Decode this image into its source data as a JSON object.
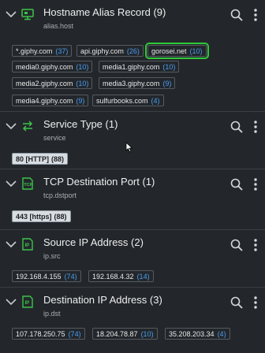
{
  "panels": [
    {
      "title": "Hostname Alias Record (9)",
      "field": "alias.host",
      "icon": "monitor-icon",
      "chips": [
        {
          "label": "*.giphy.com",
          "count": "(37)"
        },
        {
          "label": "api.giphy.com",
          "count": "(26)"
        },
        {
          "label": "gorosei.net",
          "count": "(10)",
          "highlighted": true
        },
        {
          "label": "media0.giphy.com",
          "count": "(10)"
        },
        {
          "label": "media1.giphy.com",
          "count": "(10)"
        },
        {
          "label": "media2.giphy.com",
          "count": "(10)"
        },
        {
          "label": "media3.giphy.com",
          "count": "(9)"
        },
        {
          "label": "media4.giphy.com",
          "count": "(9)"
        },
        {
          "label": "sulfurbooks.com",
          "count": "(4)"
        }
      ]
    },
    {
      "title": "Service Type (1)",
      "field": "service",
      "icon": "arrows-exchange-icon",
      "chips": [
        {
          "label": "80 [HTTP]",
          "count": "(88)",
          "selected": true
        }
      ]
    },
    {
      "title": "TCP Destination Port (1)",
      "field": "tcp.dstport",
      "icon": "tcp-icon",
      "chips": [
        {
          "label": "443 [https]",
          "count": "(88)",
          "selected": true
        }
      ]
    },
    {
      "title": "Source IP Address (2)",
      "field": "ip.src",
      "icon": "ip-icon",
      "chips": [
        {
          "label": "192.168.4.155",
          "count": "(74)"
        },
        {
          "label": "192.168.4.32",
          "count": "(14)"
        }
      ]
    },
    {
      "title": "Destination IP Address (3)",
      "field": "ip.dst",
      "icon": "ip-icon",
      "chips": [
        {
          "label": "107.178.250.75",
          "count": "(74)"
        },
        {
          "label": "18.204.78.87",
          "count": "(10)"
        },
        {
          "label": "35.208.203.34",
          "count": "(4)"
        }
      ]
    }
  ],
  "colors": {
    "background": "#23272b",
    "accent_green": "#3cc44a",
    "count_blue": "#4a9df0",
    "highlight_outline": "#2ec937"
  }
}
